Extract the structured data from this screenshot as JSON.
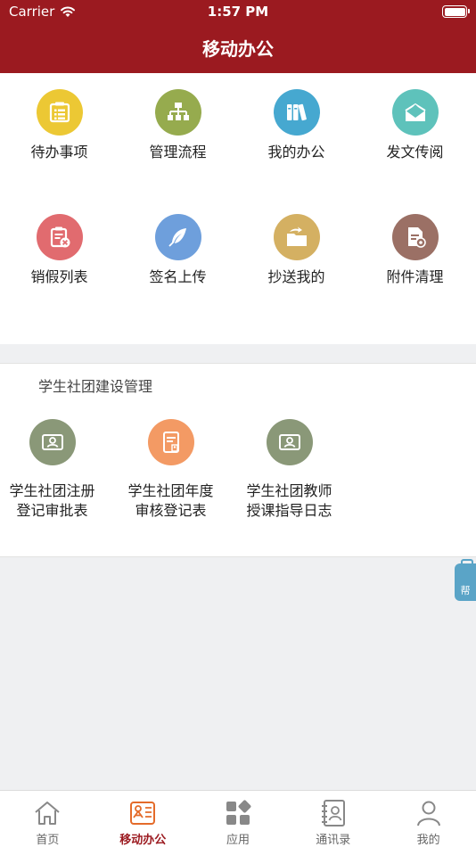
{
  "status": {
    "carrier": "Carrier",
    "time": "1:57 PM"
  },
  "nav": {
    "title": "移动办公"
  },
  "grid": {
    "items": [
      {
        "label": "待办事项",
        "icon": "list-board-icon",
        "color": "#ecc834"
      },
      {
        "label": "管理流程",
        "icon": "org-chart-icon",
        "color": "#96ab4e"
      },
      {
        "label": "我的办公",
        "icon": "binders-icon",
        "color": "#46a8d0"
      },
      {
        "label": "发文传阅",
        "icon": "mail-upload-icon",
        "color": "#5ec2bb"
      },
      {
        "label": "销假列表",
        "icon": "clipboard-cancel-icon",
        "color": "#e16b6f"
      },
      {
        "label": "签名上传",
        "icon": "feather-icon",
        "color": "#6e9fdc"
      },
      {
        "label": "抄送我的",
        "icon": "folder-arrow-icon",
        "color": "#d4b062"
      },
      {
        "label": "附件清理",
        "icon": "doc-gear-icon",
        "color": "#9b7065"
      }
    ]
  },
  "section": {
    "title": "学生社团建设管理",
    "items": [
      {
        "line1": "学生社团注册",
        "line2": "登记审批表",
        "icon": "id-card-icon",
        "color": "#8a9878"
      },
      {
        "line1": "学生社团年度",
        "line2": "审核登记表",
        "icon": "document-person-icon",
        "color": "#f39a64"
      },
      {
        "line1": "学生社团教师",
        "line2": "授课指导日志",
        "icon": "id-card-icon",
        "color": "#8a9878"
      }
    ]
  },
  "help": {
    "label": "帮"
  },
  "tabs": [
    {
      "label": "首页",
      "icon": "home-icon"
    },
    {
      "label": "移动办公",
      "icon": "office-card-icon"
    },
    {
      "label": "应用",
      "icon": "apps-grid-icon"
    },
    {
      "label": "通讯录",
      "icon": "contacts-book-icon"
    },
    {
      "label": "我的",
      "icon": "user-icon"
    }
  ],
  "colors": {
    "brand": "#9b1a20",
    "background": "#eff0f2"
  }
}
